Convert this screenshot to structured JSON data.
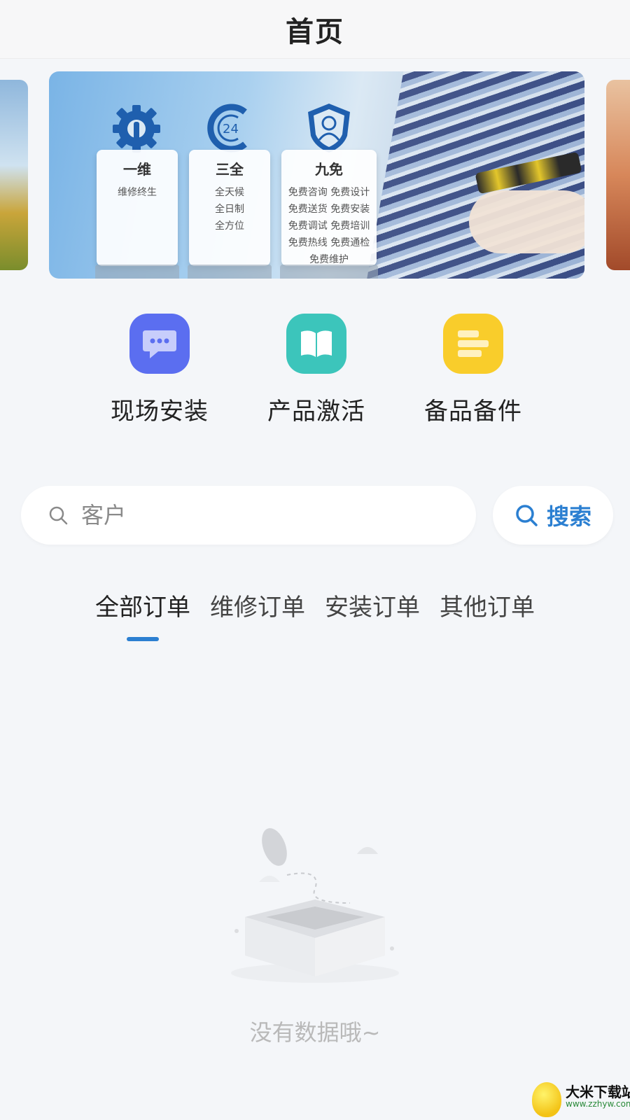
{
  "header": {
    "title": "首页"
  },
  "banner": {
    "cards": [
      {
        "title": "一维",
        "lines": [
          "维修终生"
        ]
      },
      {
        "title": "三全",
        "lines": [
          "全天候",
          "全日制",
          "全方位"
        ]
      },
      {
        "title": "九免",
        "lines": [
          "免费咨询 免费设计",
          "免费送货 免费安装",
          "免费调试 免费培训",
          "免费热线 免费通检",
          "免费维护"
        ]
      }
    ],
    "badge_24": "24",
    "icons": [
      "gear-icon",
      "clock-24-icon",
      "shield-person-icon"
    ],
    "colors": {
      "icon_blue": "#1f5fae"
    }
  },
  "quick_actions": [
    {
      "label": "现场安装",
      "icon": "chat-bubble-icon",
      "color": "#5b6ef0"
    },
    {
      "label": "产品激活",
      "icon": "book-icon",
      "color": "#3cc5bb"
    },
    {
      "label": "备品备件",
      "icon": "stack-bars-icon",
      "color": "#f9cd2b"
    }
  ],
  "search": {
    "placeholder": "客户",
    "button_label": "搜索",
    "accent": "#2b7fd1"
  },
  "tabs": [
    {
      "label": "全部订单",
      "active": true
    },
    {
      "label": "维修订单",
      "active": false
    },
    {
      "label": "安装订单",
      "active": false
    },
    {
      "label": "其他订单",
      "active": false
    }
  ],
  "empty_state": {
    "text": "没有数据哦~",
    "icon": "empty-box-icon"
  },
  "watermark": {
    "title": "大米下载站",
    "url": "www.zzhyw.com"
  }
}
